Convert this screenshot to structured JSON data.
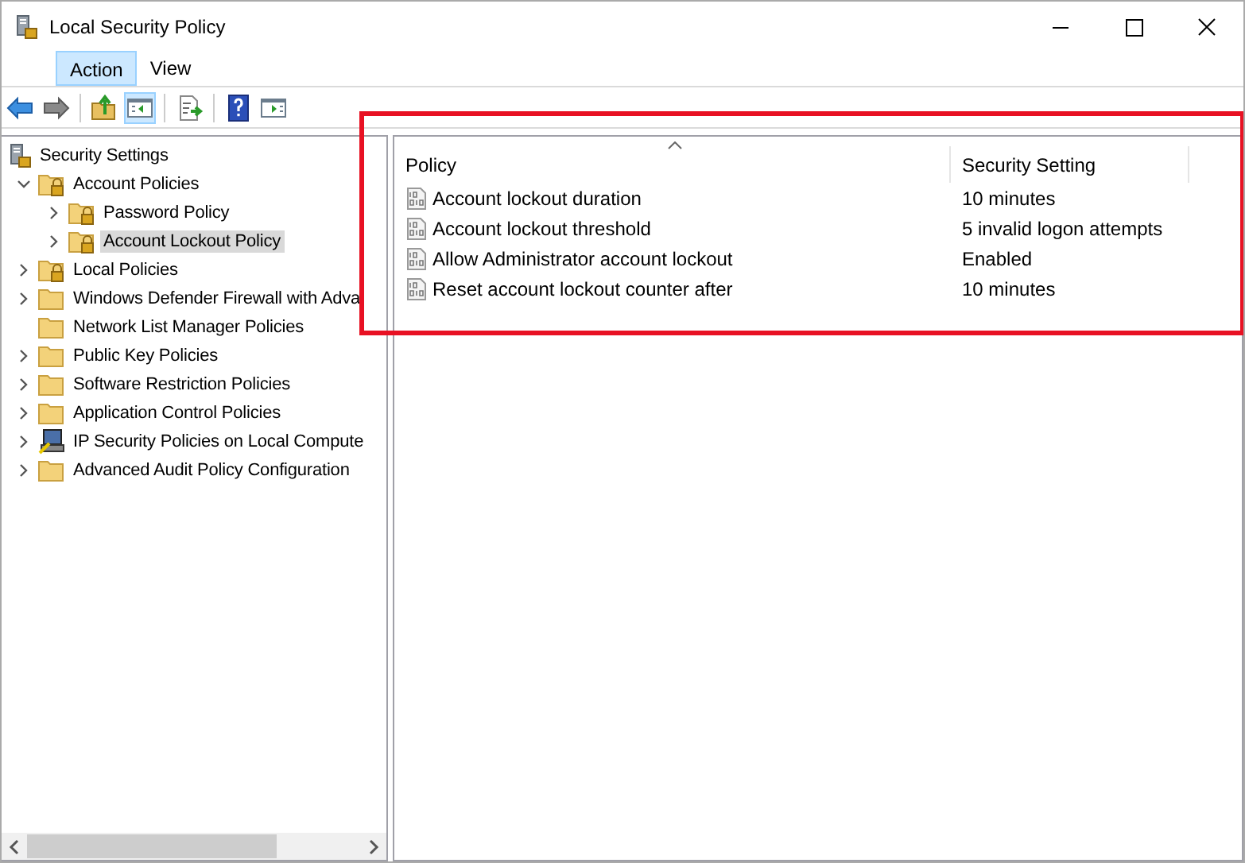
{
  "window": {
    "title": "Local Security Policy"
  },
  "menu": [
    {
      "label": "Action",
      "selected": true
    },
    {
      "label": "View",
      "selected": false
    }
  ],
  "toolbar": [
    {
      "kind": "back",
      "pressed": false
    },
    {
      "kind": "forward",
      "pressed": false
    },
    {
      "kind": "separator"
    },
    {
      "kind": "up",
      "pressed": false
    },
    {
      "kind": "tree",
      "pressed": true
    },
    {
      "kind": "separator"
    },
    {
      "kind": "export",
      "pressed": false
    },
    {
      "kind": "separator"
    },
    {
      "kind": "help",
      "pressed": false
    },
    {
      "kind": "pane",
      "pressed": false
    }
  ],
  "tree": [
    {
      "label": "Security Settings",
      "kind": "server",
      "selected": false,
      "children": [
        {
          "label": "Account Policies",
          "kind": "lockfolder",
          "selected": false,
          "expanded": true,
          "children": [
            {
              "label": "Password Policy",
              "kind": "lockfolder",
              "selected": false,
              "expanded": false
            },
            {
              "label": "Account Lockout Policy",
              "kind": "lockfolder",
              "selected": true,
              "expanded": false
            }
          ]
        },
        {
          "label": "Local Policies",
          "kind": "lockfolder",
          "selected": false,
          "expanded": false
        },
        {
          "label": "Windows Defender Firewall with Adva",
          "kind": "folder",
          "selected": false,
          "expanded": false
        },
        {
          "label": "Network List Manager Policies",
          "kind": "folder",
          "selected": false
        },
        {
          "label": "Public Key Policies",
          "kind": "folder",
          "selected": false,
          "expanded": false
        },
        {
          "label": "Software Restriction Policies",
          "kind": "folder",
          "selected": false,
          "expanded": false
        },
        {
          "label": "Application Control Policies",
          "kind": "folder",
          "selected": false,
          "expanded": false
        },
        {
          "label": "IP Security Policies on Local Compute",
          "kind": "computer",
          "selected": false,
          "expanded": false
        },
        {
          "label": "Advanced Audit Policy Configuration",
          "kind": "folder",
          "selected": false,
          "expanded": false
        }
      ]
    }
  ],
  "table": {
    "columns": [
      "Policy",
      "Security Setting"
    ],
    "rows": [
      {
        "policy": "Account lockout duration",
        "setting": "10 minutes"
      },
      {
        "policy": "Account lockout threshold",
        "setting": "5 invalid logon attempts"
      },
      {
        "policy": "Allow Administrator account lockout",
        "setting": "Enabled"
      },
      {
        "policy": "Reset account lockout counter after",
        "setting": "10 minutes"
      }
    ]
  }
}
